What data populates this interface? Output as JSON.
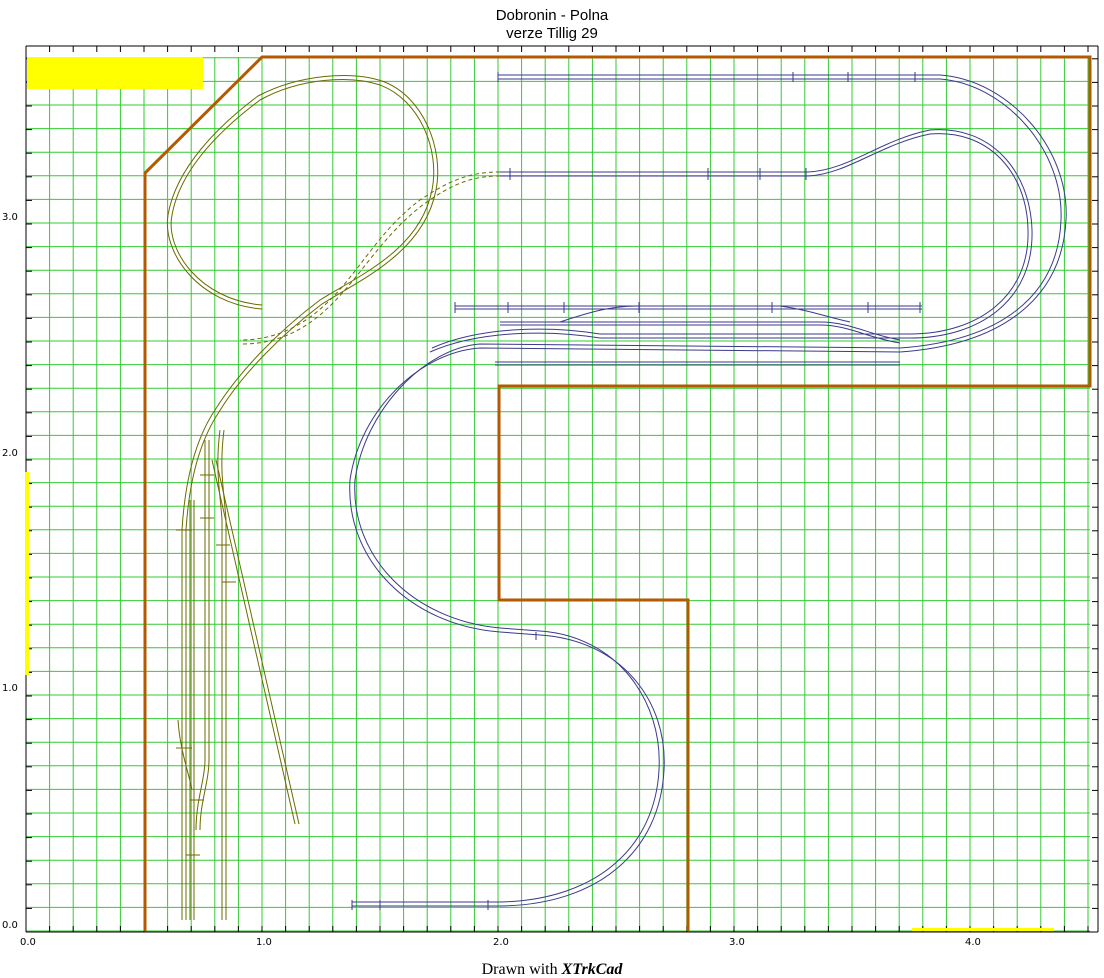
{
  "plan": {
    "title": "Dobronin - Polna",
    "subtitle": "verze Tillig 29",
    "footer_prefix": "Drawn with ",
    "footer_brand": "XTrkCad",
    "x_ticks": [
      "0.0",
      "1.0",
      "2.0",
      "3.0",
      "4.0"
    ],
    "y_ticks": [
      "0.0",
      "1.0",
      "2.0",
      "3.0"
    ],
    "colors": {
      "grid": "#33cc33",
      "benchwork": "#b35a00",
      "track_blue": "#3a3a8c",
      "track_olive": "#6b6b00",
      "marker": "#ffff00"
    }
  }
}
